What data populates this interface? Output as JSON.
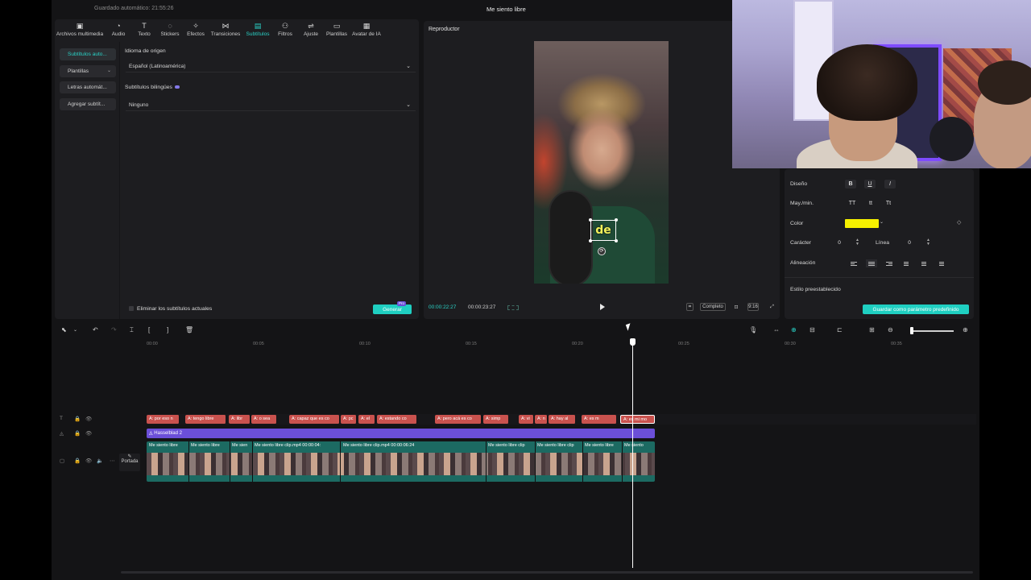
{
  "titlebar": {
    "saved_status": "Guardado automático: 21:55:26",
    "project_title": "Me siento libre"
  },
  "toolbar": {
    "items": [
      {
        "label": "Archivos multimedia",
        "icon": "media-icon"
      },
      {
        "label": "Audio",
        "icon": "audio-icon"
      },
      {
        "label": "Texto",
        "icon": "text-icon"
      },
      {
        "label": "Stickers",
        "icon": "sticker-icon"
      },
      {
        "label": "Efectos",
        "icon": "effects-icon"
      },
      {
        "label": "Transiciones",
        "icon": "transitions-icon"
      },
      {
        "label": "Subtítulos",
        "icon": "subtitles-icon",
        "active": true
      },
      {
        "label": "Filtros",
        "icon": "filters-icon"
      },
      {
        "label": "Ajuste",
        "icon": "adjust-icon"
      },
      {
        "label": "Plantillas",
        "icon": "templates-icon"
      },
      {
        "label": "Avatar de IA",
        "icon": "ai-avatar-icon"
      }
    ]
  },
  "sidenav": {
    "items": [
      {
        "label": "Subtítulos auto..."
      },
      {
        "label": "Plantillas"
      },
      {
        "label": "Letras automát..."
      },
      {
        "label": "Agregar subtít..."
      }
    ]
  },
  "subtitles": {
    "source_language_label": "Idioma de origen",
    "source_language_value": "Español (Latinoamérica)",
    "bilingual_label": "Subtítulos bilingües",
    "bilingual_value": "Ninguno",
    "remove_existing_label": "Eliminar los subtítulos actuales",
    "generate_label": "Generar",
    "pro_badge": "Pro"
  },
  "player": {
    "title": "Reproductor",
    "caption_text": "de",
    "time_current": "00:00:22:27",
    "time_total": "00:00:23:27",
    "full_label": "Completo",
    "ratio_label": "9:16"
  },
  "properties": {
    "design_label": "Diseño",
    "case_label": "May./min.",
    "case_options": [
      "TT",
      "tt",
      "Tt"
    ],
    "color_label": "Color",
    "color_value": "#F6F000",
    "character_label": "Carácter",
    "character_value": "0",
    "line_label": "Línea",
    "line_value": "0",
    "alignment_label": "Alineación",
    "preset_label": "Estilo preestablecido",
    "save_preset_label": "Guardar como parámetro predefinido"
  },
  "timeline": {
    "ruler": [
      "00:00",
      "00:05",
      "00:10",
      "00:15",
      "00:20",
      "00:25",
      "00:30",
      "00:35"
    ],
    "caption_clips": [
      "A: por eso n",
      "A: tengo libre",
      "A: libr",
      "A: o sea",
      "A: capaz que es co",
      "A: pc",
      "A: el",
      "A: estando co",
      "A: pero acá es co",
      "A: simp",
      "A: vi",
      "A: n",
      "A: hay al",
      "A: es m",
      "A: es mi mo"
    ],
    "effect_label": "Hasselblad 2",
    "video_clips": [
      "Me siento libre",
      "Me siento libre",
      "Me sien",
      "Me siento libre clip.mp4   00:00:04:",
      "Me siento libre clip.mp4   00:00:06:24",
      "Me siento libre clip",
      "Me siento libre clip",
      "Me siento libre",
      "Me siento"
    ],
    "cover_label": "Portada"
  }
}
